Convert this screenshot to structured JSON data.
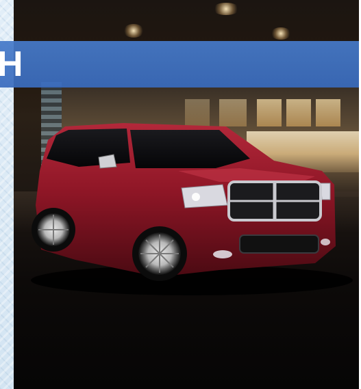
{
  "banner": {
    "text": "H",
    "color": "#3f73c4"
  },
  "side_strip": {
    "color": "#dbe9f4"
  },
  "photo": {
    "subject": "red-suv-night-city",
    "vehicle_color": "#8e1626"
  }
}
